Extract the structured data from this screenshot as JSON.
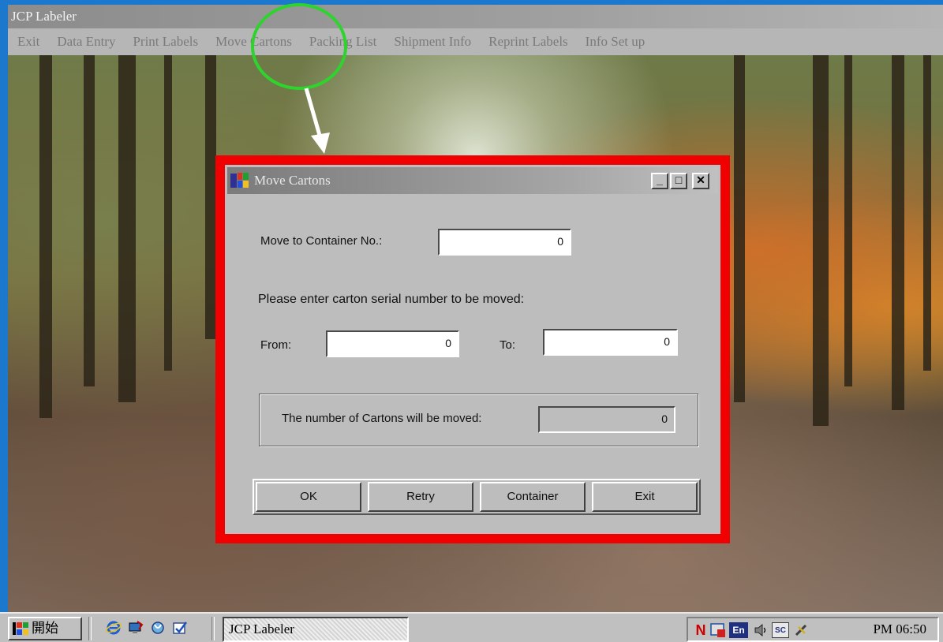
{
  "app": {
    "title": "JCP Labeler",
    "menu": [
      "Exit",
      "Data Entry",
      "Print Labels",
      "Move Cartons",
      "Packing List",
      "Shipment Info",
      "Reprint Labels",
      "Info Set up"
    ],
    "highlighted_menu": "Move Cartons"
  },
  "dialog": {
    "title": "Move Cartons",
    "container_label": "Move to Container No.:",
    "container_value": "0",
    "instruction": "Please enter carton serial number to be moved:",
    "from_label": "From:",
    "from_value": "0",
    "to_label": "To:",
    "to_value": "0",
    "count_label": "The number of Cartons will be moved:",
    "count_value": "0",
    "buttons": {
      "ok": "OK",
      "retry": "Retry",
      "container": "Container",
      "exit": "Exit"
    },
    "window_controls": {
      "minimize": "_",
      "maximize": "□",
      "close": "✕"
    }
  },
  "taskbar": {
    "start_label": "開始",
    "task_item": "JCP Labeler",
    "clock": "PM 06:50",
    "tray": {
      "n": "N",
      "en": "En",
      "sc": "SC"
    }
  },
  "colors": {
    "highlight_red": "#f00000",
    "annotation_green": "#2ed32e",
    "desktop_blue": "#1b78cc"
  },
  "icons": [
    "windows-logo-icon",
    "ie-icon",
    "desktop-icon",
    "channel-icon",
    "outlook-icon",
    "ime-icon",
    "speaker-icon",
    "network-icon"
  ]
}
